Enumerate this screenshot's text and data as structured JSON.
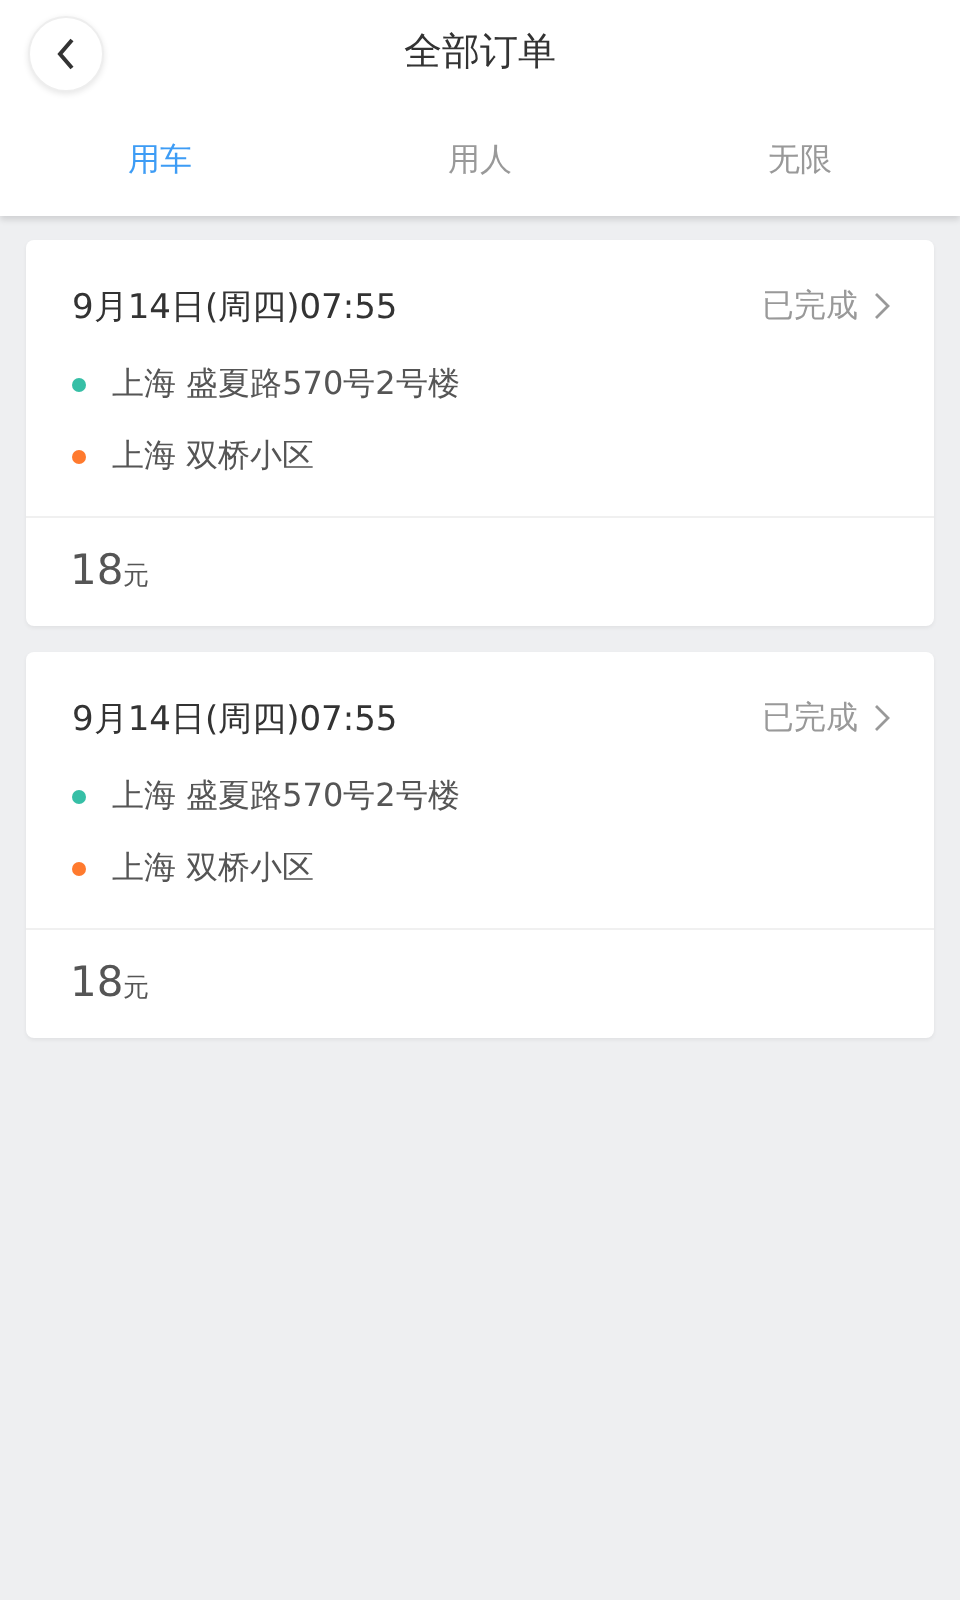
{
  "header": {
    "title": "全部订单"
  },
  "tabs": [
    {
      "label": "用车",
      "selected": true
    },
    {
      "label": "用人",
      "selected": false
    },
    {
      "label": "无限",
      "selected": false
    }
  ],
  "orders": [
    {
      "time": "9月14日(周四)07:55",
      "status": "已完成",
      "stops": [
        {
          "address": "上海 盛夏路570号2号楼",
          "color": "#36bfa6"
        },
        {
          "address": "上海 双桥小区",
          "color": "#ff7a2e"
        }
      ],
      "price": "18",
      "unit": "元"
    },
    {
      "time": "9月14日(周四)07:55",
      "status": "已完成",
      "stops": [
        {
          "address": "上海 盛夏路570号2号楼",
          "color": "#36bfa6"
        },
        {
          "address": "上海 双桥小区",
          "color": "#ff7a2e"
        }
      ],
      "price": "18",
      "unit": "元"
    }
  ]
}
